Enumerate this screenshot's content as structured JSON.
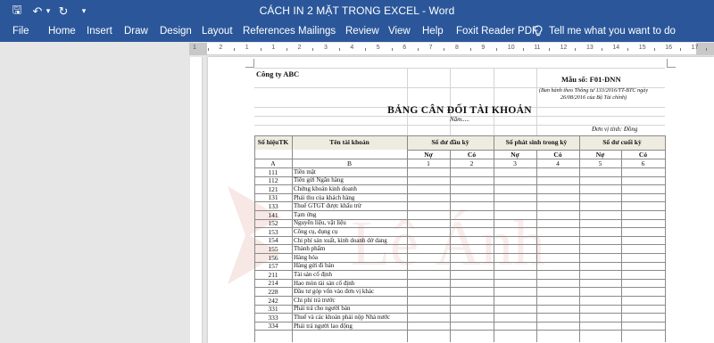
{
  "window": {
    "title": "CÁCH IN 2 MẶT TRONG EXCEL - Word",
    "accent": "#2b579a"
  },
  "quick_access": [
    {
      "name": "save-icon",
      "glyph": "🖫"
    },
    {
      "name": "undo-icon",
      "glyph": "↶"
    },
    {
      "name": "undo-dropdown-icon",
      "glyph": "▾"
    },
    {
      "name": "redo-icon",
      "glyph": "↻"
    },
    {
      "name": "customize-qat-icon",
      "glyph": "▾"
    }
  ],
  "ribbon": {
    "tabs": [
      "File",
      "Home",
      "Insert",
      "Draw",
      "Design",
      "Layout",
      "References",
      "Mailings",
      "Review",
      "View",
      "Help",
      "Foxit Reader PDF"
    ],
    "tell_me": "Tell me what you want to do",
    "tell_me_icon": "lightbulb-icon"
  },
  "ruler": {
    "numbers": [
      "1",
      "2",
      "1",
      "1",
      "2",
      "3",
      "4",
      "5",
      "6",
      "7",
      "8",
      "9",
      "10",
      "11",
      "12",
      "13",
      "14",
      "15",
      "16",
      "17",
      "18"
    ]
  },
  "sheet": {
    "company": "Công ty ABC",
    "form_code": "Mẫu số: F01-DNN",
    "form_note_1": "(Ban hành theo Thông tư 133/2016/TT-BTC ngày",
    "form_note_2": "26/08/2016 của Bộ Tài chính)",
    "title": "BẢNG CÂN ĐỐI TÀI KHOẢN",
    "year": "Năm.....",
    "unit": "Đơn vị tính: Đồng",
    "headers": {
      "account_no": "Số hiệuTK",
      "account_name": "Tên tài khoản",
      "opening": "Số dư đầu kỳ",
      "period": "Số phát sinh trong kỳ",
      "closing": "Số dư cuối kỳ",
      "debit": "Nợ",
      "credit": "Có"
    },
    "col_codes": [
      "A",
      "B",
      "1",
      "2",
      "3",
      "4",
      "5",
      "6"
    ],
    "rows": [
      {
        "code": "111",
        "name": "Tiền mặt"
      },
      {
        "code": "112",
        "name": "Tiền gửi Ngân hàng"
      },
      {
        "code": "121",
        "name": "Chứng khoán kinh doanh"
      },
      {
        "code": "131",
        "name": "Phải thu của khách hàng"
      },
      {
        "code": "133",
        "name": "Thuế GTGT được khấu trừ"
      },
      {
        "code": "141",
        "name": "Tạm ứng"
      },
      {
        "code": "152",
        "name": "Nguyên liệu, vật liệu"
      },
      {
        "code": "153",
        "name": "Công cụ, dụng cụ"
      },
      {
        "code": "154",
        "name": "Chi phí sản xuất, kinh doanh dở dang"
      },
      {
        "code": "155",
        "name": "Thành phẩm"
      },
      {
        "code": "156",
        "name": "Hàng hóa"
      },
      {
        "code": "157",
        "name": "Hàng gửi đi bán"
      },
      {
        "code": "211",
        "name": "Tài sản cố định"
      },
      {
        "code": "214",
        "name": "Hao mòn tài sản cố định"
      },
      {
        "code": "228",
        "name": "Đầu tư góp vốn vào đơn vị khác"
      },
      {
        "code": "242",
        "name": "Chi phí trả trước"
      },
      {
        "code": "331",
        "name": "Phải trả cho người bán"
      },
      {
        "code": "333",
        "name": "Thuế và các khoản phải nộp Nhà nước"
      },
      {
        "code": "334",
        "name": "Phải trả người lao động"
      }
    ]
  },
  "watermark": {
    "text": "Lê Ánh",
    "color": "#c0392b"
  }
}
